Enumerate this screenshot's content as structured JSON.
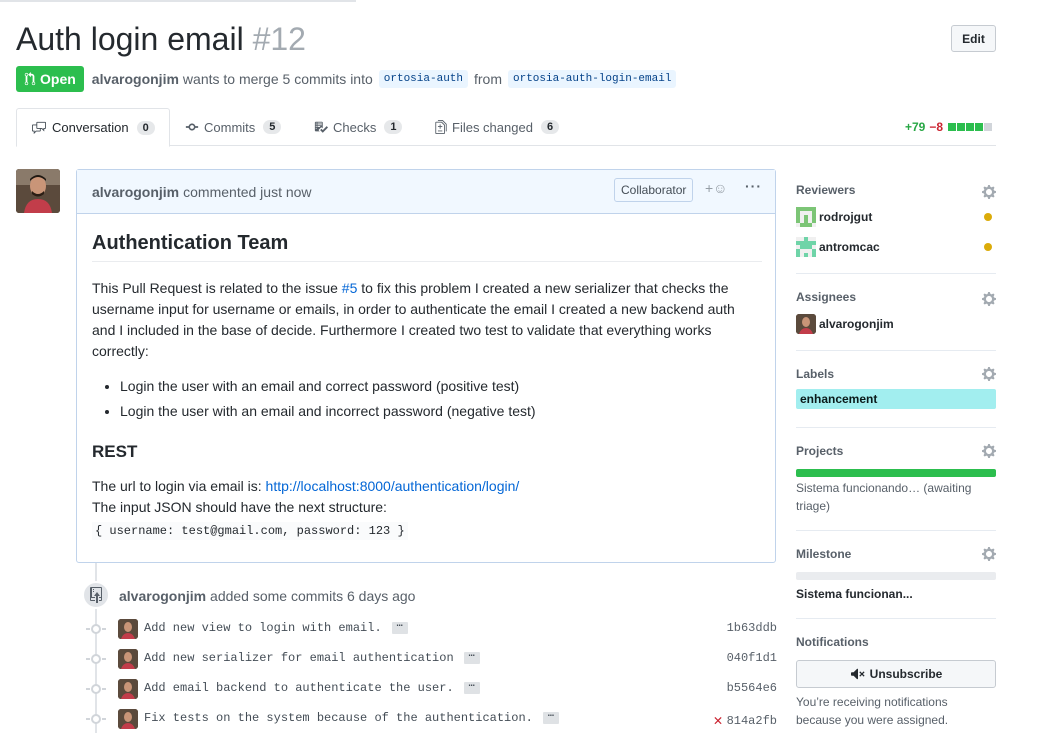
{
  "pr": {
    "title": "Auth login email",
    "number": "#12",
    "edit_label": "Edit",
    "state": "Open",
    "author": "alvarogonjim",
    "merge_text": "wants to merge 5 commits into",
    "base_branch": "ortosia-auth",
    "from_text": "from",
    "head_branch": "ortosia-auth-login-email"
  },
  "tabs": [
    {
      "label": "Conversation",
      "count": "0",
      "icon": "comment-discussion-icon"
    },
    {
      "label": "Commits",
      "count": "5",
      "icon": "git-commit-icon"
    },
    {
      "label": "Checks",
      "count": "1",
      "icon": "checklist-icon"
    },
    {
      "label": "Files changed",
      "count": "6",
      "icon": "file-diff-icon"
    }
  ],
  "diffstat": {
    "additions": "+79",
    "deletions": "−8"
  },
  "comment": {
    "author": "alvarogonjim",
    "action": "commented just now",
    "role": "Collaborator",
    "reaction": "+☺",
    "more": "···",
    "heading": "Authentication Team",
    "para_before_link": "This Pull Request is related to the issue ",
    "issue_link": "#5",
    "para_after_link": " to fix this problem I created a new serializer that checks the username input for username or emails, in order to authenticate the email I created a new backend auth and I included in the base of decide. Furthermore I created two test to validate that everything works correctly:",
    "bullets": [
      "Login the user with an email and correct password (positive test)",
      "Login the user with an email and incorrect password (negative test)"
    ],
    "subheading": "REST",
    "url_intro": "The url to login via email is: ",
    "url": "http://localhost:8000/authentication/login/",
    "json_intro": "The input JSON should have the next structure:",
    "code": "{ username: test@gmail.com, password: 123 }"
  },
  "timeline": {
    "author": "alvarogonjim",
    "action": "added some commits 6 days ago",
    "commits": [
      {
        "message": "Add new view to login with email.",
        "sha": "1b63ddb",
        "status": ""
      },
      {
        "message": "Add new serializer for email authentication",
        "sha": "040f1d1",
        "status": ""
      },
      {
        "message": "Add email backend to authenticate the user.",
        "sha": "b5564e6",
        "status": ""
      },
      {
        "message": "Fix tests on the system because of the authentication.",
        "sha": "814a2fb",
        "status": "✕"
      }
    ],
    "ellipsis": "…"
  },
  "sidebar": {
    "reviewers": {
      "title": "Reviewers",
      "items": [
        {
          "name": "rodrojgut",
          "status_color": "#dbab09"
        },
        {
          "name": "antromcac",
          "status_color": "#dbab09"
        }
      ]
    },
    "assignees": {
      "title": "Assignees",
      "name": "alvarogonjim"
    },
    "labels": {
      "title": "Labels",
      "label": "enhancement",
      "color": "#a2eeef"
    },
    "projects": {
      "title": "Projects",
      "text": "Sistema funcionando… (awaiting triage)",
      "progress": 1.0
    },
    "milestone": {
      "title": "Milestone",
      "text": "Sistema funcionan...",
      "progress": 0.0
    },
    "notifications": {
      "title": "Notifications",
      "button": "Unsubscribe",
      "reason": "You’re receiving notifications because you were assigned."
    }
  },
  "colors": {
    "open_green": "#2cbe4e",
    "link_blue": "#0366d6",
    "label_cyan": "#a2eeef"
  }
}
